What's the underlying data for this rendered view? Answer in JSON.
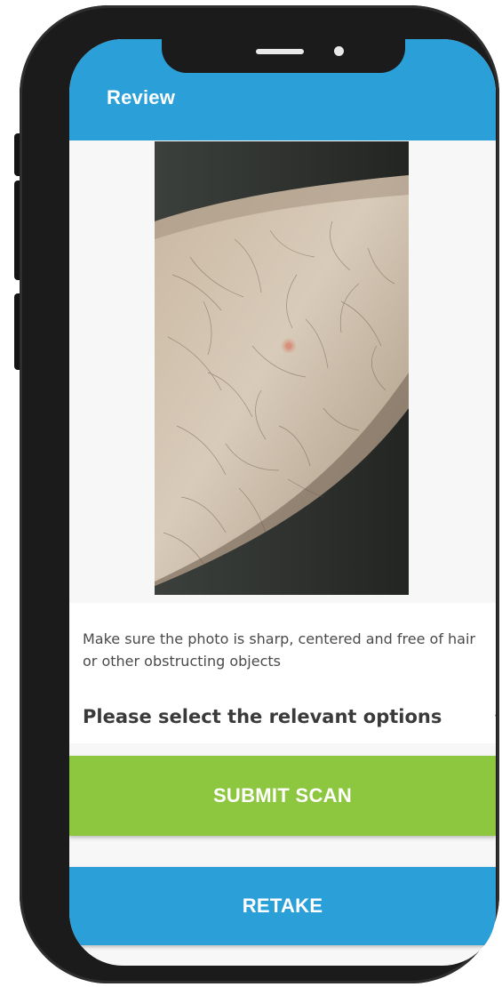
{
  "appbar": {
    "title": "Review",
    "color": "#2b9fd8"
  },
  "photo": {
    "description_icon": "skin-photo"
  },
  "instructions": {
    "hint": "Make sure the photo is sharp, centered and free of hair or other obstructing objects"
  },
  "options": {
    "label": "Please select the relevant options",
    "icon": "chevron-down-icon"
  },
  "actions": {
    "submit_label": "SUBMIT SCAN",
    "submit_color": "#8dc63f",
    "retake_label": "RETAKE",
    "retake_color": "#2b9fd8"
  }
}
